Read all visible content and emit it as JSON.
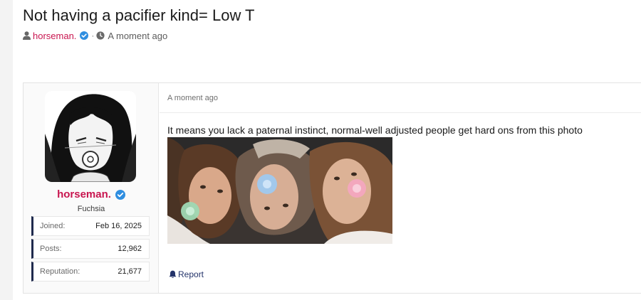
{
  "thread": {
    "title": "Not having a pacifier kind= Low T",
    "author": "horseman.",
    "time": "A moment ago"
  },
  "user": {
    "name": "horseman.",
    "title": "Fuchsia",
    "stats": [
      {
        "label": "Joined:",
        "value": "Feb 16, 2025"
      },
      {
        "label": "Posts:",
        "value": "12,962"
      },
      {
        "label": "Reputation:",
        "value": "21,677"
      }
    ]
  },
  "post": {
    "date": "A moment ago",
    "text": "It means you lack a paternal instinct, normal-well adjusted people get hard ons from this photo",
    "report_label": "Report"
  },
  "colors": {
    "username": "#c8154f",
    "verified": "#2f8ee0",
    "stat_accent": "#1f2a4d",
    "link": "#23336a"
  }
}
